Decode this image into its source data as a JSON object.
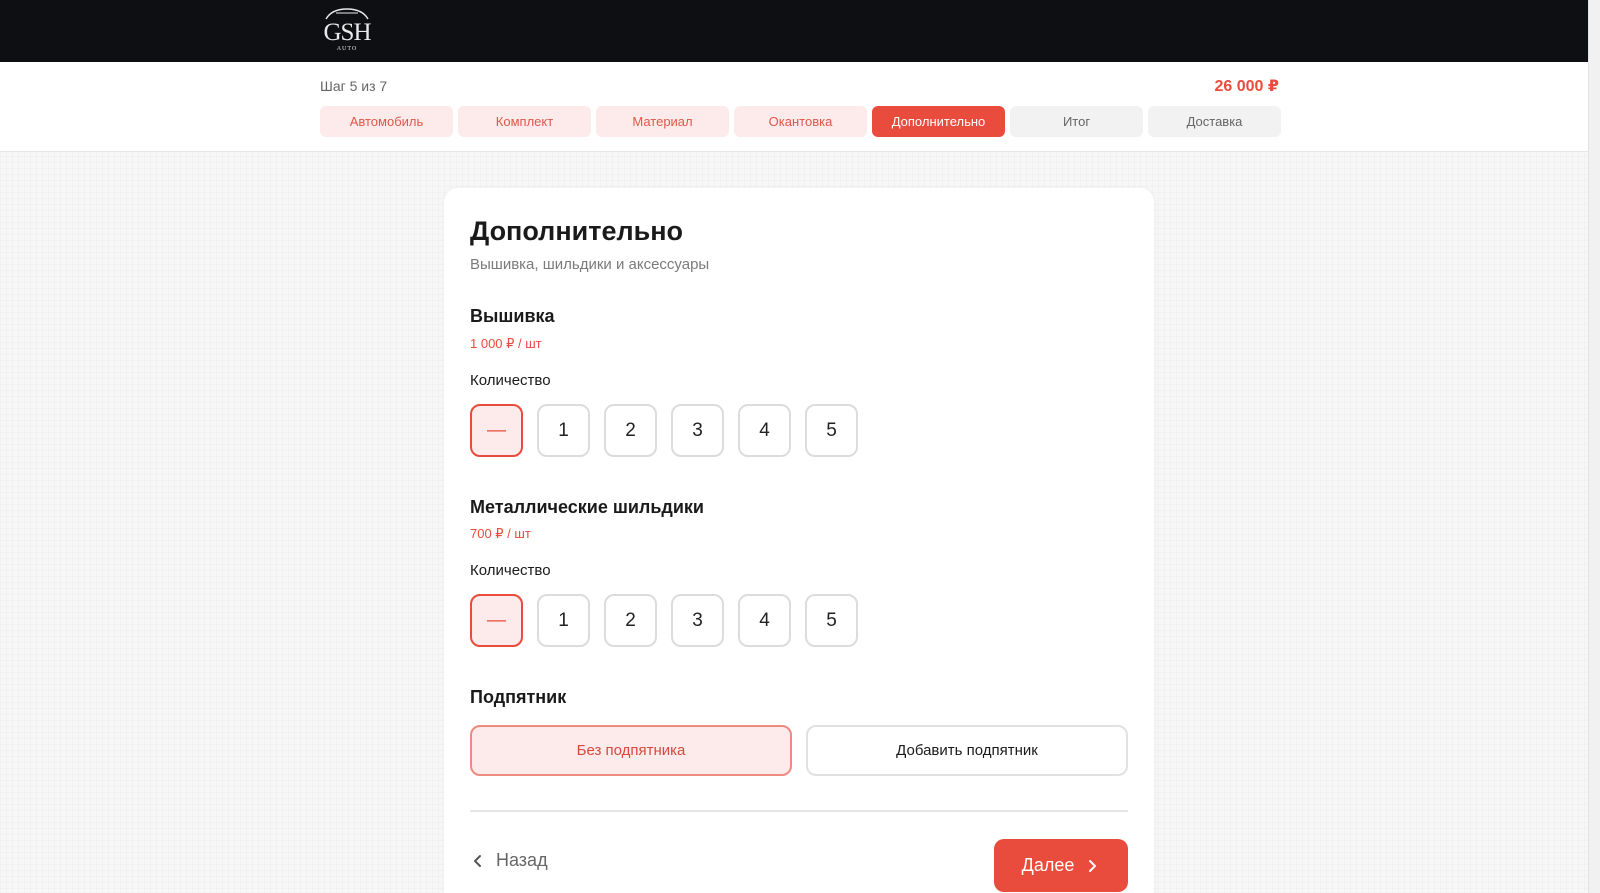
{
  "header": {
    "logo_text": "GSH",
    "logo_subtext": "AUTO"
  },
  "progress": {
    "step_text": "Шаг 5 из 7",
    "total": "26 000 ₽",
    "current_step": 5,
    "total_steps": 7
  },
  "tabs": [
    {
      "label": "Автомобиль",
      "state": "done"
    },
    {
      "label": "Комплект",
      "state": "done"
    },
    {
      "label": "Материал",
      "state": "done"
    },
    {
      "label": "Окантовка",
      "state": "done"
    },
    {
      "label": "Дополнительно",
      "state": "active"
    },
    {
      "label": "Итог",
      "state": "todo"
    },
    {
      "label": "Доставка",
      "state": "todo"
    }
  ],
  "card": {
    "title": "Дополнительно",
    "subtitle": "Вышивка, шильдики и аксессуары"
  },
  "embroidery": {
    "title": "Вышивка",
    "price": "1 000 ₽ / шт",
    "qty_label": "Количество",
    "options": [
      "—",
      "1",
      "2",
      "3",
      "4",
      "5"
    ],
    "selected": "—"
  },
  "badges": {
    "title": "Металлические шильдики",
    "price": "700 ₽ / шт",
    "qty_label": "Количество",
    "options": [
      "—",
      "1",
      "2",
      "3",
      "4",
      "5"
    ],
    "selected": "—"
  },
  "mat": {
    "title": "Подпятник",
    "options": [
      "Без подпятника",
      "Добавить подпятник"
    ],
    "selected": "Без подпятника"
  },
  "nav": {
    "back_label": "Назад",
    "next_label": "Далее"
  },
  "colors": {
    "accent": "#e94b3c",
    "accent_light": "#fdeaea",
    "header_bg": "#0d0f13"
  }
}
